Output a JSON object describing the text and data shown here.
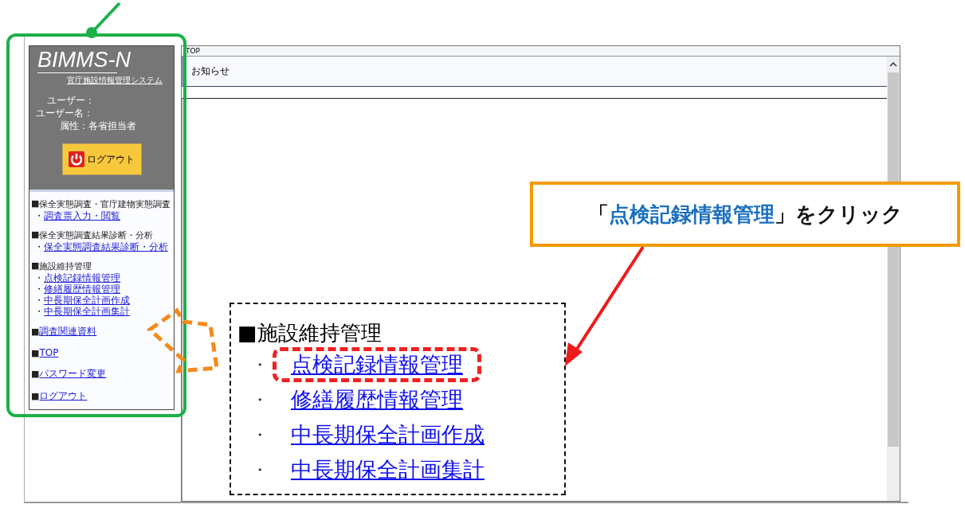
{
  "sidebar": {
    "logo": "BIMMS-N",
    "subtitle": "官庁施設情報管理システム",
    "user_fields": [
      {
        "label": "ユーザー："
      },
      {
        "label": "ユーザー名："
      },
      {
        "label": "属性：",
        "value": "各省担当者"
      }
    ],
    "logout_button": "ログアウト",
    "menu": [
      {
        "kind": "section",
        "marker": "■",
        "heading": "保全実態調査・官庁建物実態調査",
        "links": [
          {
            "bullet": "・",
            "label": "調査票入力・閲覧"
          }
        ]
      },
      {
        "kind": "section",
        "marker": "■",
        "heading": "保全実態調査結果診断・分析",
        "links": [
          {
            "bullet": "・",
            "label": "保全実態調査結果診断・分析"
          }
        ]
      },
      {
        "kind": "section",
        "marker": "■",
        "heading": "施設維持管理",
        "links": [
          {
            "bullet": "・",
            "label": "点検記録情報管理"
          },
          {
            "bullet": "・",
            "label": "修繕履歴情報管理"
          },
          {
            "bullet": "・",
            "label": "中長期保全計画作成"
          },
          {
            "bullet": "・",
            "label": "中長期保全計画集計"
          }
        ]
      },
      {
        "kind": "link",
        "marker": "■",
        "label": "調査関連資料"
      },
      {
        "kind": "link",
        "marker": "■",
        "label": "TOP"
      },
      {
        "kind": "link",
        "marker": "■",
        "label": "パスワード変更"
      },
      {
        "kind": "link",
        "marker": "■",
        "label": "ログアウト"
      }
    ]
  },
  "main": {
    "breadcrumb": "TOP",
    "heading": "お知らせ"
  },
  "callout": {
    "parts": [
      {
        "text": "「",
        "highlight": false
      },
      {
        "text": "点検記録情報管理",
        "highlight": true
      },
      {
        "text": "」をクリック",
        "highlight": false
      }
    ]
  },
  "inset": {
    "marker": "■",
    "heading": "施設維持管理",
    "links": [
      {
        "bullet": "・",
        "label": "点検記録情報管理",
        "circled": true
      },
      {
        "bullet": "・",
        "label": "修繕履歴情報管理",
        "circled": false
      },
      {
        "bullet": "・",
        "label": "中長期保全計画作成",
        "circled": false
      },
      {
        "bullet": "・",
        "label": "中長期保全計画集計",
        "circled": false
      }
    ]
  }
}
